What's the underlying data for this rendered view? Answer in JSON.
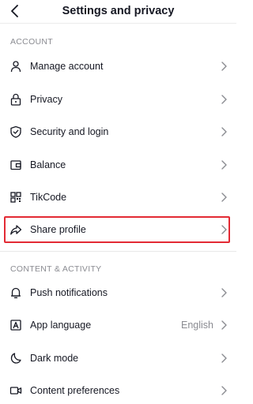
{
  "header": {
    "title": "Settings and privacy"
  },
  "sections": {
    "account": {
      "title": "ACCOUNT",
      "items": [
        {
          "label": "Manage account",
          "icon": "person-icon"
        },
        {
          "label": "Privacy",
          "icon": "lock-icon"
        },
        {
          "label": "Security and login",
          "icon": "shield-icon"
        },
        {
          "label": "Balance",
          "icon": "wallet-icon"
        },
        {
          "label": "TikCode",
          "icon": "qr-code-icon"
        },
        {
          "label": "Share profile",
          "icon": "share-icon"
        }
      ]
    },
    "content": {
      "title": "CONTENT & ACTIVITY",
      "items": [
        {
          "label": "Push notifications",
          "icon": "bell-icon"
        },
        {
          "label": "App language",
          "value": "English",
          "icon": "language-icon"
        },
        {
          "label": "Dark mode",
          "icon": "moon-icon"
        },
        {
          "label": "Content preferences",
          "icon": "video-icon"
        }
      ]
    }
  },
  "colors": {
    "highlight": "#e32a34",
    "text": "#161823",
    "muted": "#8a8b91"
  }
}
